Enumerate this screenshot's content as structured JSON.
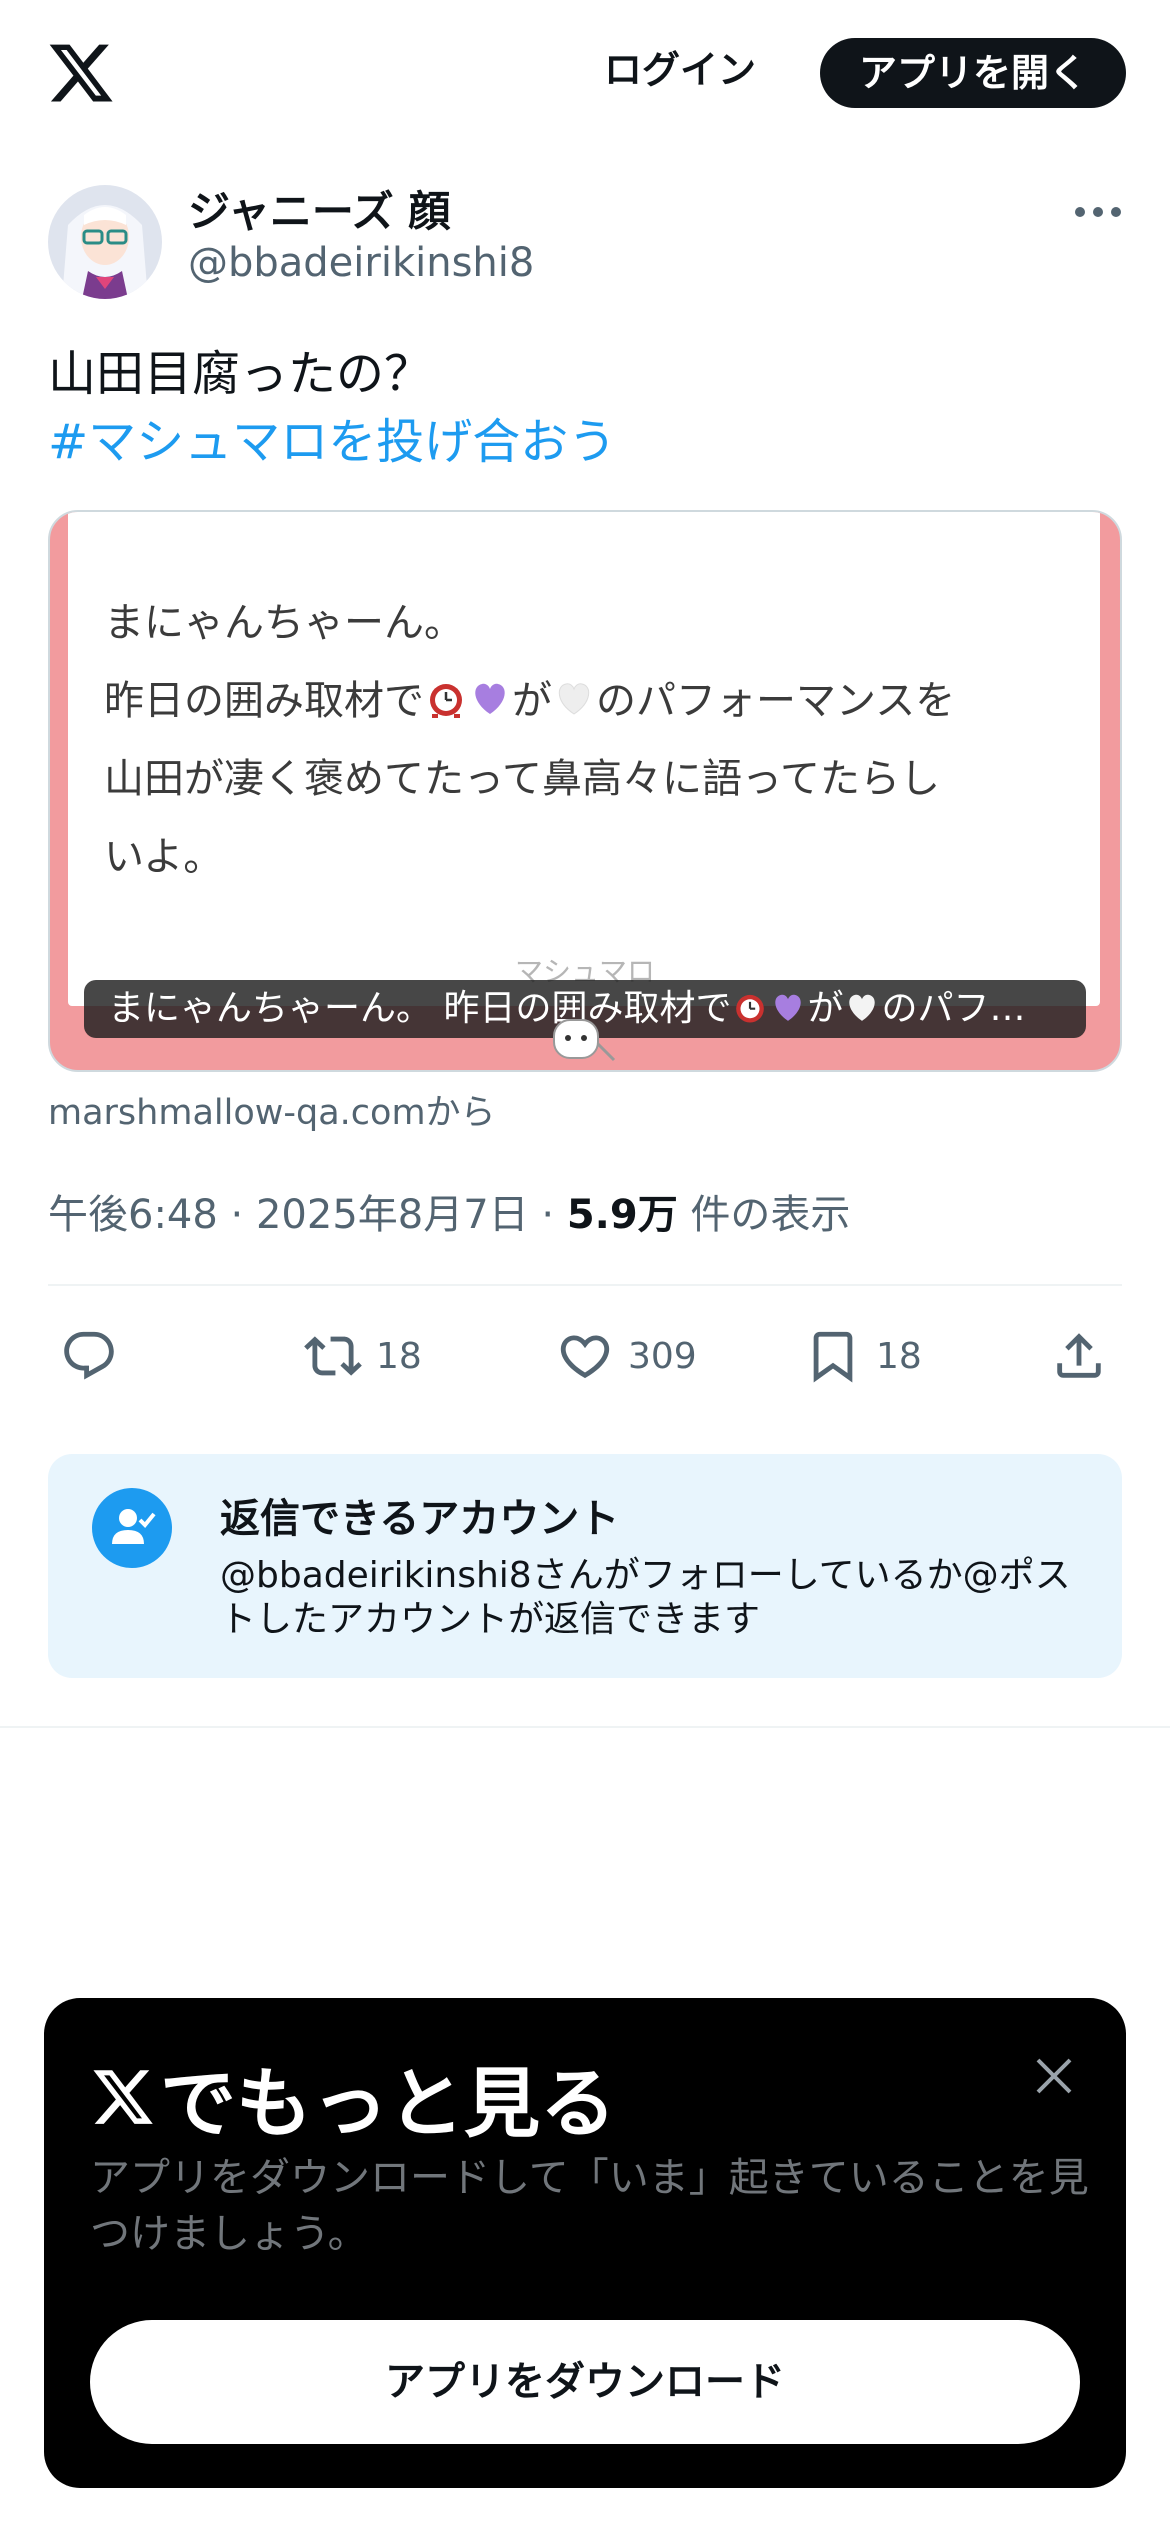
{
  "header": {
    "logo_icon": "x-logo-icon",
    "login_label": "ログイン",
    "open_app_label": "アプリを開く"
  },
  "author": {
    "display_name": "ジャニーズ 顔",
    "handle": "@bbadeirikinshi8",
    "avatar_icon": "avatar-illustration"
  },
  "tweet": {
    "text": "山田目腐ったの？",
    "hashtag": "#マシュマロを投げ合おう"
  },
  "card": {
    "body_line1": "まにゃんちゃーん。",
    "body_line2_a": "昨日の囲み取材で",
    "body_line2_b": "が",
    "body_line2_c": "のパフォーマンスを",
    "body_line3": "山田が凄く褒めてたって鼻高々に語ってたらし",
    "body_line4": "いよ。",
    "brand": "マシュマロ",
    "caption_a": "まにゃんちゃーん。 昨日の囲み取材で",
    "caption_b": "が",
    "caption_c": "のパフ…",
    "source": "marshmallow-qa.comから",
    "emoji": [
      "clock-emoji",
      "purple-heart-emoji",
      "white-heart-emoji"
    ]
  },
  "meta": {
    "time": "午後6:48",
    "date": "2025年8月7日",
    "views_count": "5.9万",
    "views_label": "件の表示",
    "separator": "·"
  },
  "actions": {
    "reply_icon": "reply-icon",
    "retweet_count": "18",
    "like_count": "309",
    "bookmark_count": "18",
    "share_icon": "share-icon"
  },
  "reply_restriction": {
    "title": "返信できるアカウント",
    "description": "@bbadeirikinshi8さんがフォローしているか@ポストしたアカウントが返信できます"
  },
  "bottom_sheet": {
    "title": "でもっと見る",
    "description": "アプリをダウンロードして「いま」起きていることを見つけましょう。",
    "button_label": "アプリをダウンロード"
  },
  "colors": {
    "accent": "#1d9bf0",
    "text": "#0f1419",
    "muted": "#536471",
    "card_frame": "#f29b9e",
    "reply_box_bg": "#e8f5fd"
  }
}
